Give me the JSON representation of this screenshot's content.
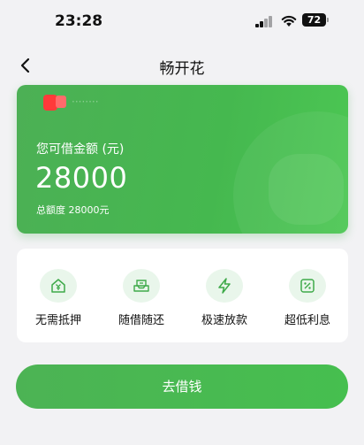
{
  "status_bar": {
    "time": "23:28",
    "battery": "72"
  },
  "nav": {
    "title": "畅开花"
  },
  "card": {
    "user_name": "········",
    "amount_label": "您可借金额 (元)",
    "amount": "28000",
    "total_line": "总额度 28000元"
  },
  "features": [
    {
      "label": "无需抵押",
      "icon": "house-yuan-icon"
    },
    {
      "label": "随借随还",
      "icon": "cash-tray-icon"
    },
    {
      "label": "极速放款",
      "icon": "lightning-icon"
    },
    {
      "label": "超低利息",
      "icon": "percent-icon"
    }
  ],
  "cta": {
    "label": "去借钱"
  },
  "colors": {
    "brand_green": "#45b84f",
    "icon_green": "#3faa4a",
    "icon_bg": "#e9f6eb"
  }
}
